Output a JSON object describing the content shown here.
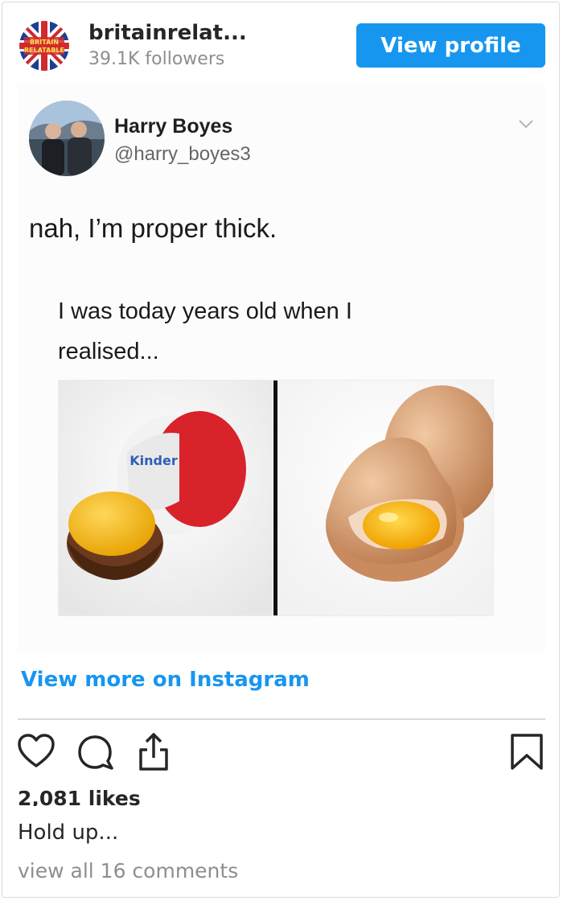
{
  "header": {
    "account_name": "britainrelat...",
    "followers": "39.1K followers",
    "view_profile_label": "View profile",
    "avatar_text": [
      "BRITAIN",
      "RELATABLE"
    ],
    "avatar_icon": "union-jack-logo-icon"
  },
  "post_image": {
    "tweet_author_name": "Harry Boyes",
    "tweet_author_handle": "@harry_boyes3",
    "tweet_text": "nah, I’m proper thick.",
    "meme_caption": "I was today years old when I realised...",
    "meme_left_alt": "kinder-surprise-egg",
    "meme_right_alt": "cracked-chicken-egg"
  },
  "view_more_label": "View more on Instagram",
  "actions": {
    "icons": [
      "heart-icon",
      "comment-icon",
      "share-icon",
      "bookmark-icon"
    ]
  },
  "likes": "2,081 likes",
  "caption": "Hold up...",
  "comments_link": "view all 16 comments",
  "colors": {
    "accent": "#1796f0",
    "muted": "#8e8e8e",
    "text": "#262626",
    "divider": "#dbdbdb"
  }
}
